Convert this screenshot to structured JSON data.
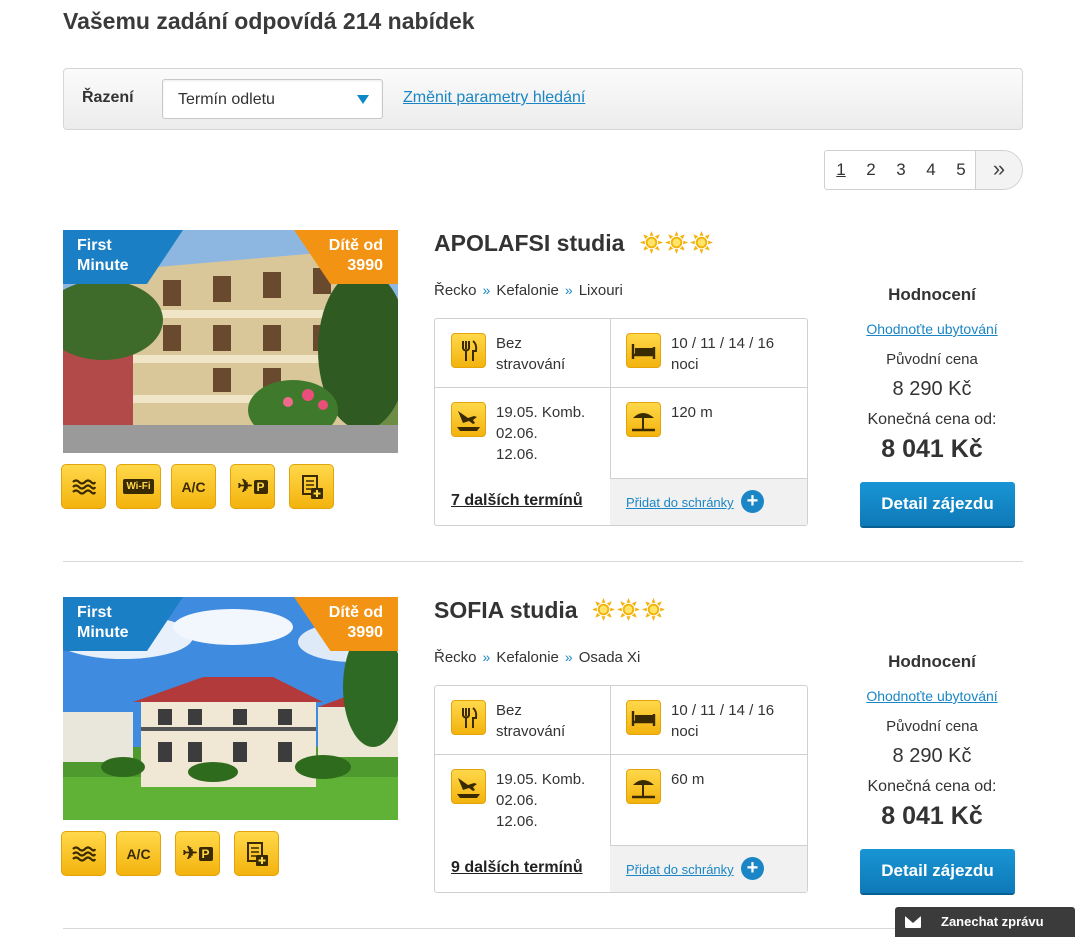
{
  "header": {
    "title": "Vašemu zadání odpovídá 214 nabídek"
  },
  "sort": {
    "label": "Řazení",
    "selected": "Termín odletu",
    "change_link": "Změnit parametry hledání"
  },
  "pagination": {
    "pages": [
      "1",
      "2",
      "3",
      "4",
      "5"
    ],
    "current": "1",
    "next": "»"
  },
  "offers": [
    {
      "ribbon_left": [
        "First",
        "Minute"
      ],
      "ribbon_right": [
        "Dítě od",
        "3990"
      ],
      "name": "APOLAFSI studia",
      "stars": 3,
      "location": [
        "Řecko",
        "Kefalonie",
        "Lixouri"
      ],
      "meal": [
        "Bez",
        "stravování"
      ],
      "nights": [
        "10 / 11 / 14 / 16",
        "noci"
      ],
      "dates": [
        "19.05. Komb.",
        "02.06.",
        "12.06."
      ],
      "beach": "120 m",
      "more_dates": "7 dalších termínů",
      "add_to_clipboard": "Přidat do schránky",
      "amenities": [
        "pool-icon",
        "wifi-icon",
        "ac-icon",
        "airport-parking-icon",
        "insurance-icon"
      ],
      "rating_title": "Hodnocení",
      "rate_link": "Ohodnoťte ubytování",
      "orig_label": "Původní cena",
      "orig_price": "8 290 Kč",
      "final_label": "Konečná cena od:",
      "final_price": "8 041 Kč",
      "detail_button": "Detail zájezdu"
    },
    {
      "ribbon_left": [
        "First",
        "Minute"
      ],
      "ribbon_right": [
        "Dítě od",
        "3990"
      ],
      "name": "SOFIA studia",
      "stars": 3,
      "location": [
        "Řecko",
        "Kefalonie",
        "Osada Xi"
      ],
      "meal": [
        "Bez",
        "stravování"
      ],
      "nights": [
        "10 / 11 / 14 / 16",
        "noci"
      ],
      "dates": [
        "19.05. Komb.",
        "02.06.",
        "12.06."
      ],
      "beach": "60 m",
      "more_dates": "9 dalších termínů",
      "add_to_clipboard": "Přidat do schránky",
      "amenities": [
        "pool-icon",
        "ac-icon",
        "airport-parking-icon",
        "insurance-icon"
      ],
      "rating_title": "Hodnocení",
      "rate_link": "Ohodnoťte ubytování",
      "orig_label": "Původní cena",
      "orig_price": "8 290 Kč",
      "final_label": "Konečná cena od:",
      "final_price": "8 041 Kč",
      "detail_button": "Detail zájezdu"
    }
  ],
  "amenity_labels": {
    "wifi": "Wi-Fi",
    "ac": "A/C",
    "parking": "P"
  },
  "chat": {
    "label": "Zanechat zprávu"
  },
  "colors": {
    "accent_blue": "#1a86c5",
    "orange": "#f39314",
    "yellow": "#f3b30d"
  }
}
